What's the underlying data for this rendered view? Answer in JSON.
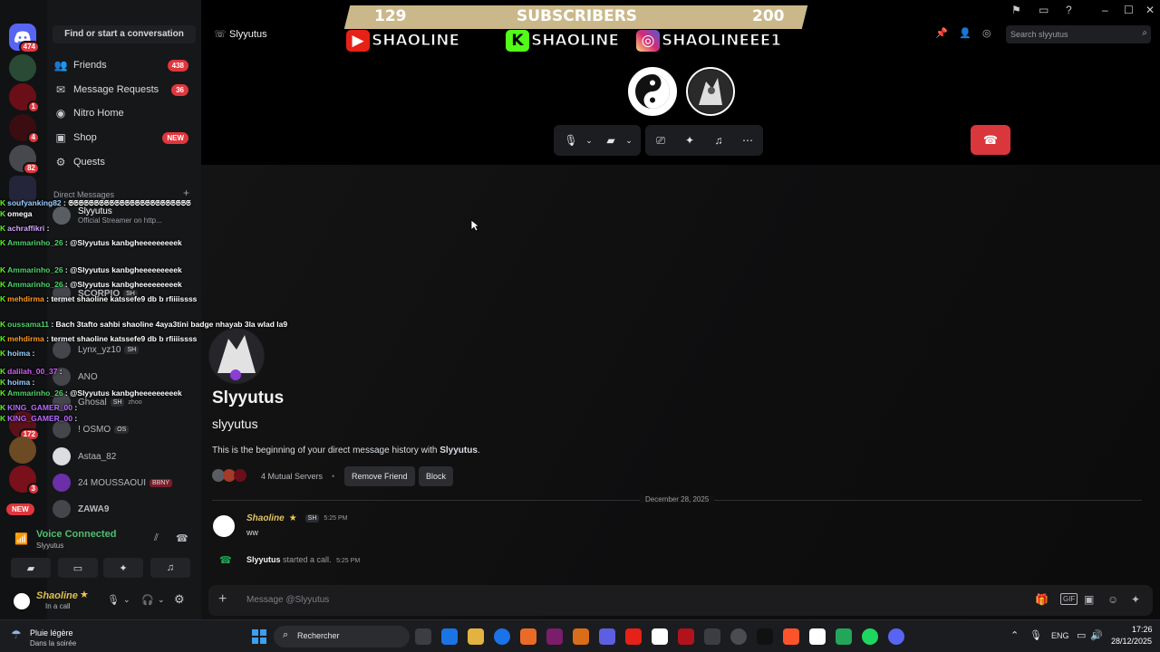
{
  "app": {
    "title": "Discord"
  },
  "header": {
    "channel_name": "Slyyutus",
    "search_placeholder": "Search slyyutus"
  },
  "sidebar": {
    "search_label": "Find or start a conversation",
    "nav": [
      {
        "label": "Friends",
        "badge": "438",
        "icon": "friends-icon"
      },
      {
        "label": "Message Requests",
        "badge": "36",
        "icon": "mail-icon"
      },
      {
        "label": "Nitro Home",
        "badge": "",
        "icon": "nitro-icon"
      },
      {
        "label": "Shop",
        "badge": "NEW",
        "icon": "shop-icon"
      },
      {
        "label": "Quests",
        "badge": "",
        "icon": "quests-icon"
      }
    ],
    "dm_header": "Direct Messages",
    "dms": [
      {
        "name": "Slyyutus",
        "sub": "Official Streamer on http...",
        "tag": ""
      },
      {
        "name": "SCORPIO",
        "sub": "",
        "tag": "SH"
      },
      {
        "name": "Lynx_yz10",
        "sub": "",
        "tag": "SH"
      },
      {
        "name": "ANO",
        "sub": "",
        "tag": ""
      },
      {
        "name": "Ghosal",
        "sub": "zhoo",
        "tag": "SH"
      },
      {
        "name": "! OSMO",
        "sub": "",
        "tag": "OS"
      },
      {
        "name": "Astaa_82",
        "sub": "",
        "tag": ""
      },
      {
        "name": "24 MOUSSAOUI",
        "sub": "",
        "tag": "BBNY"
      },
      {
        "name": "ZAWA9",
        "sub": "",
        "tag": ""
      }
    ]
  },
  "servers": {
    "badges": [
      "474",
      "1",
      "4",
      "82",
      "172",
      "3",
      "NEW"
    ]
  },
  "voice": {
    "title": "Voice Connected",
    "channel": "Slyyutus"
  },
  "user": {
    "name": "Shaoline",
    "status": "In a call"
  },
  "overlay": {
    "subs_left": "129",
    "subs_label": "SUBSCRIBERS",
    "subs_right": "200",
    "socials": [
      {
        "platform": "youtube",
        "handle": "SHAOLINE",
        "color": "#e62117"
      },
      {
        "platform": "kick",
        "handle": "SHAOLINE",
        "color": "#53fc18"
      },
      {
        "platform": "instagram",
        "handle": "SHAOLINEEE1",
        "color": "#c13584"
      }
    ]
  },
  "twitch_chat": [
    {
      "user": "soufyanking82",
      "text": ": 𝕾𝕾𝕾𝕾𝕾𝕾𝕾𝕾𝕾𝕾𝕾𝕾𝕾𝕾𝕾𝕾𝕾𝕾𝕾𝕾𝕾𝕾𝕾𝕾",
      "color": "#9bd0ff"
    },
    {
      "user": "omega",
      "text": "",
      "color": "#ffffff"
    },
    {
      "user": "achraffikri",
      "text": ":",
      "color": "#d5a6ff"
    },
    {
      "user": "Ammarinho_26",
      "text": ": @Slyyutus kanbgheeeeeeeeek",
      "color": "#4fd36a"
    },
    {
      "user": "Ammarinho_26",
      "text": ": @Slyyutus kanbgheeeeeeeeek",
      "color": "#4fd36a"
    },
    {
      "user": "Ammarinho_26",
      "text": ": @Slyyutus kanbgheeeeeeeeek",
      "color": "#4fd36a"
    },
    {
      "user": "mehdirma",
      "text": ": termet shaoline katssefe9 db b rfiiiissss",
      "color": "#ff9a1f"
    },
    {
      "user": "oussama11",
      "text": ": Bach 3tafto sahbi shaoline 4aya3tini badge nhayab 3la wlad la9",
      "color": "#4fd36a"
    },
    {
      "user": "mehdirma",
      "text": ": termet shaoline katssefe9 db b rfiiiissss",
      "color": "#ff9a1f"
    },
    {
      "user": "hoima",
      "text": ":",
      "color": "#9bd0ff"
    },
    {
      "user": "dalilah_00_37",
      "text": ":",
      "color": "#d95cff"
    },
    {
      "user": "hoima",
      "text": ":",
      "color": "#9bd0ff"
    },
    {
      "user": "Ammarinho_26",
      "text": ": @Slyyutus kanbgheeeeeeeeek",
      "color": "#4fd36a"
    },
    {
      "user": "KING_GAMER_00",
      "text": ":",
      "color": "#b86bff"
    },
    {
      "user": "KING_GAMER_00",
      "text": ":",
      "color": "#b86bff"
    }
  ],
  "profile": {
    "display_name": "Slyyutus",
    "username": "slyyutus",
    "intro_prefix": "This is the beginning of your direct message history with ",
    "intro_name": "Slyyutus",
    "intro_suffix": ".",
    "mutual_servers": "4 Mutual Servers",
    "remove_friend": "Remove Friend",
    "block": "Block"
  },
  "messages": {
    "date_divider": "December 28, 2025",
    "first": {
      "author": "Shaoline",
      "tag": "SH",
      "time": "5:25 PM",
      "text": "ww"
    },
    "system": {
      "author": "Slyyutus",
      "text": "started a call.",
      "time": "5:25 PM"
    }
  },
  "composer": {
    "placeholder": "Message @Slyyutus"
  },
  "taskbar": {
    "weather_title": "Pluie légère",
    "weather_sub": "Dans la soirée",
    "search_label": "Rechercher",
    "lang": "ENG",
    "time": "17:26",
    "date": "28/12/2025"
  },
  "colors": {
    "accent_red": "#da373c",
    "green": "#23a55a",
    "blurple": "#5865f2"
  }
}
